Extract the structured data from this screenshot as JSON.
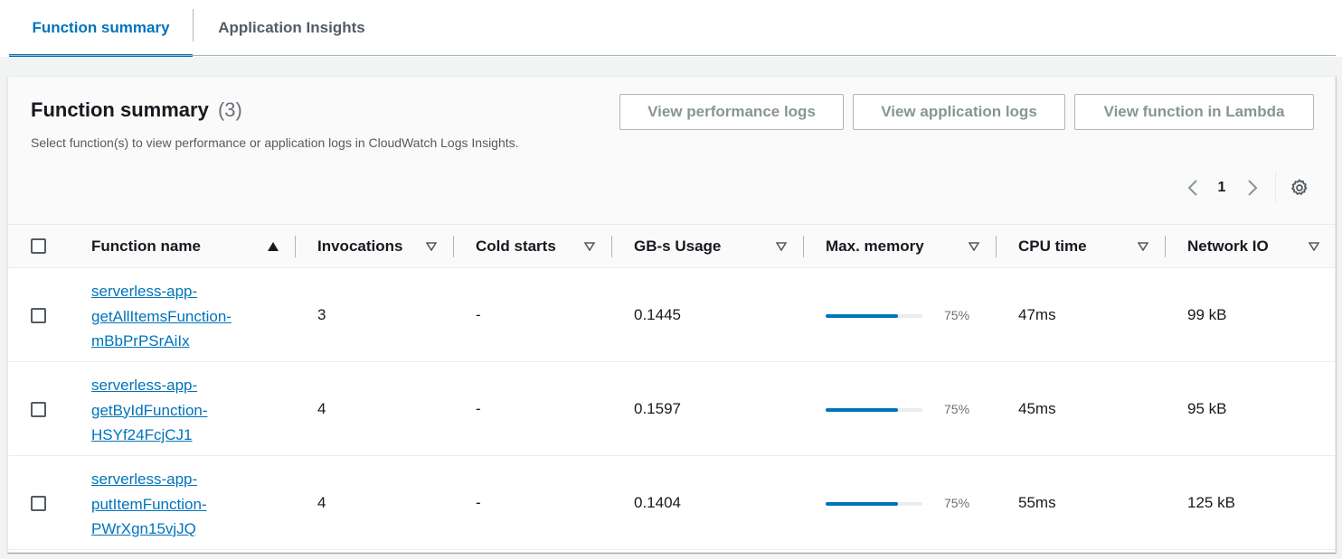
{
  "tabs": [
    {
      "label": "Function summary",
      "active": true
    },
    {
      "label": "Application Insights",
      "active": false
    }
  ],
  "panel": {
    "title": "Function summary",
    "count": "(3)",
    "description": "Select function(s) to view performance or application logs in CloudWatch Logs Insights.",
    "buttons": {
      "performance_logs": "View performance logs",
      "application_logs": "View application logs",
      "function_in_lambda": "View function in Lambda"
    },
    "pagination": {
      "current_page": "1"
    }
  },
  "table": {
    "columns": {
      "function_name": "Function name",
      "invocations": "Invocations",
      "cold_starts": "Cold starts",
      "gbs_usage": "GB-s Usage",
      "max_memory": "Max. memory",
      "cpu_time": "CPU time",
      "network_io": "Network IO"
    },
    "rows": [
      {
        "name": "serverless-app-getAllItemsFunction-mBbPrPSrAiIx",
        "name_lines": [
          "serverless-app-",
          "getAllItemsFunction-",
          "mBbPrPSrAiIx"
        ],
        "invocations": "3",
        "cold_starts": "-",
        "gbs_usage": "0.1445",
        "max_memory_pct": "75%",
        "max_memory_fraction": 0.75,
        "cpu_time": "47ms",
        "network_io": "99 kB"
      },
      {
        "name": "serverless-app-getByIdFunction-HSYf24FcjCJ1",
        "name_lines": [
          "serverless-app-",
          "getByIdFunction-",
          "HSYf24FcjCJ1"
        ],
        "invocations": "4",
        "cold_starts": "-",
        "gbs_usage": "0.1597",
        "max_memory_pct": "75%",
        "max_memory_fraction": 0.75,
        "cpu_time": "45ms",
        "network_io": "95 kB"
      },
      {
        "name": "serverless-app-putItemFunction-PWrXgn15vjJQ",
        "name_lines": [
          "serverless-app-",
          "putItemFunction-",
          "PWrXgn15vjJQ"
        ],
        "invocations": "4",
        "cold_starts": "-",
        "gbs_usage": "0.1404",
        "max_memory_pct": "75%",
        "max_memory_fraction": 0.75,
        "cpu_time": "55ms",
        "network_io": "125 kB"
      }
    ]
  },
  "colors": {
    "accent": "#0073bb",
    "text": "#16191f",
    "muted": "#879596"
  },
  "icons": [
    "chevron-left-icon",
    "chevron-right-icon",
    "settings-gear-icon",
    "sort-ascending-icon",
    "sort-descending-icon"
  ]
}
